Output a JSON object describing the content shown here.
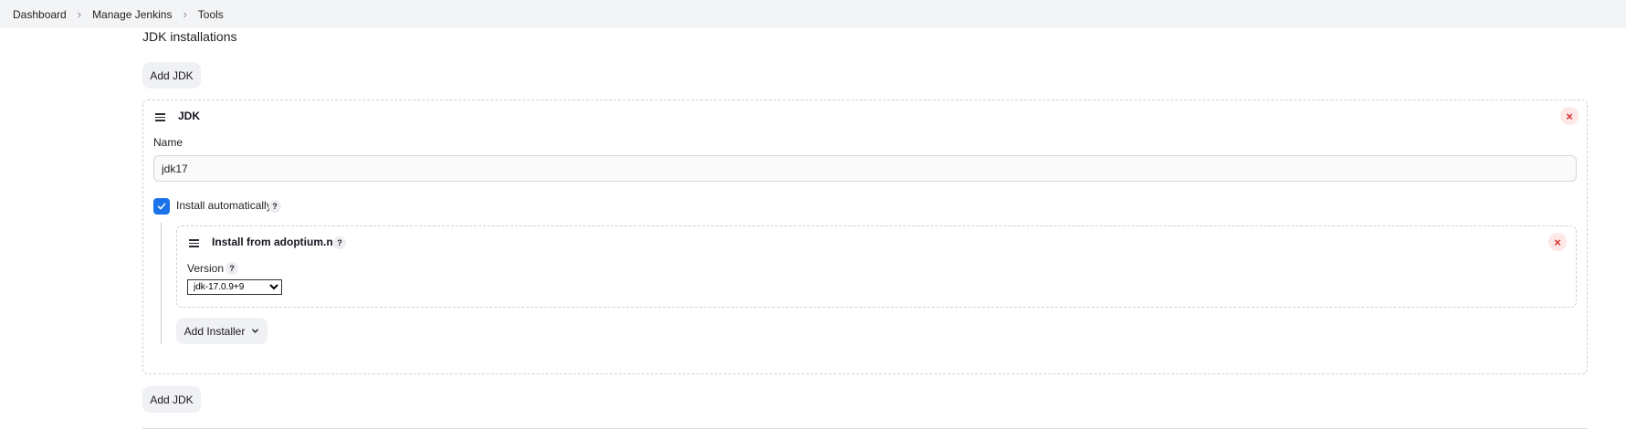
{
  "breadcrumb": {
    "items": [
      "Dashboard",
      "Manage Jenkins",
      "Tools"
    ],
    "separator": "›"
  },
  "section": {
    "title": "JDK installations",
    "add_button_label": "Add JDK"
  },
  "jdk": {
    "title": "JDK",
    "name_label": "Name",
    "name_value": "jdk17",
    "install_auto_label": "Install automatically",
    "install_auto_checked": true,
    "installer": {
      "title": "Install from adoptium.net",
      "version_label": "Version",
      "version_selected": "jdk-17.0.9+9"
    },
    "add_installer_label": "Add Installer"
  },
  "icons": {
    "close": "close-icon",
    "drag": "drag-handle-icon",
    "help": "help-icon",
    "check": "checkmark-icon",
    "chevron": "chevron-down-icon"
  },
  "colors": {
    "accent": "#1a73e8",
    "danger": "#d92d2d",
    "danger_bg": "#fde7e7",
    "button_bg": "#f0f1f4",
    "topbar_bg": "#f3f4f6"
  },
  "help_glyph": "?",
  "close_glyph": "×"
}
